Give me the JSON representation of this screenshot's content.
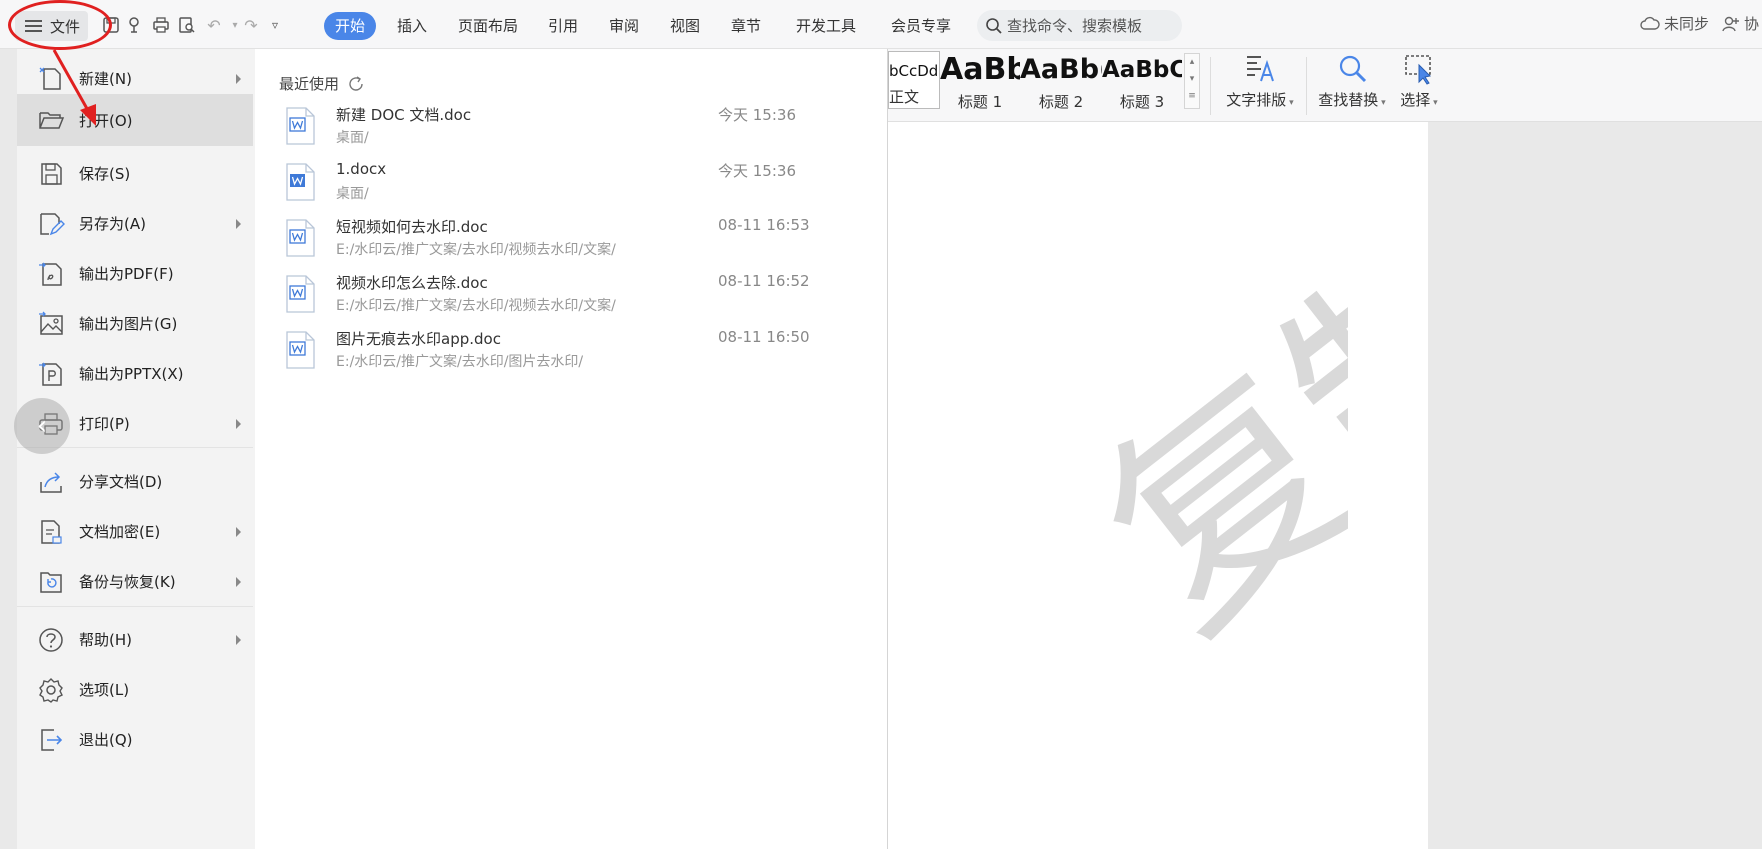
{
  "topbar": {
    "file_label": "文件",
    "tabs": [
      "开始",
      "插入",
      "页面布局",
      "引用",
      "审阅",
      "视图",
      "章节",
      "开发工具",
      "会员专享"
    ],
    "search_placeholder": "查找命令、搜索模板",
    "sync_label": "未同步",
    "collab_label": "协"
  },
  "ribbon": {
    "styles": [
      {
        "sample": "bCcDd",
        "label": "正文"
      },
      {
        "sample": "AaBb",
        "label": "标题 1"
      },
      {
        "sample": "AaBb(",
        "label": "标题 2"
      },
      {
        "sample": "AaBbC",
        "label": "标题 3"
      }
    ],
    "layout_label": "文字排版",
    "find_label": "查找替换",
    "select_label": "选择"
  },
  "menu": {
    "items": [
      {
        "label": "新建(N)",
        "icon": "new-file-icon"
      },
      {
        "label": "打开(O)",
        "icon": "open-folder-icon"
      },
      {
        "label": "保存(S)",
        "icon": "save-icon"
      },
      {
        "label": "另存为(A)",
        "icon": "save-as-icon"
      },
      {
        "label": "输出为PDF(F)",
        "icon": "export-pdf-icon"
      },
      {
        "label": "输出为图片(G)",
        "icon": "export-image-icon"
      },
      {
        "label": "输出为PPTX(X)",
        "icon": "export-pptx-icon"
      },
      {
        "label": "打印(P)",
        "icon": "print-icon"
      },
      {
        "label": "分享文档(D)",
        "icon": "share-icon"
      },
      {
        "label": "文档加密(E)",
        "icon": "encrypt-icon"
      },
      {
        "label": "备份与恢复(K)",
        "icon": "backup-icon"
      },
      {
        "label": "帮助(H)",
        "icon": "help-icon"
      },
      {
        "label": "选项(L)",
        "icon": "options-gear-icon"
      },
      {
        "label": "退出(Q)",
        "icon": "exit-icon"
      }
    ]
  },
  "recent": {
    "title": "最近使用",
    "files": [
      {
        "name": "新建 DOC 文档.doc",
        "path": "桌面/",
        "time": "今天 15:36"
      },
      {
        "name": "1.docx",
        "path": "桌面/",
        "time": "今天 15:36"
      },
      {
        "name": "短视频如何去水印.doc",
        "path": "E:/水印云/推广文案/去水印/视频去水印/文案/",
        "time": "08-11 16:53"
      },
      {
        "name": "视频水印怎么去除.doc",
        "path": "E:/水印云/推广文案/去水印/视频去水印/文案/",
        "time": "08-11 16:52"
      },
      {
        "name": "图片无痕去水印app.doc",
        "path": "E:/水印云/推广文案/去水印/图片去水印/",
        "time": "08-11 16:50"
      }
    ]
  },
  "document": {
    "watermark_text": "复制"
  },
  "colors": {
    "accent": "#4a86e8",
    "annotation": "#e02020",
    "word_icon": "#3f7ad8"
  }
}
